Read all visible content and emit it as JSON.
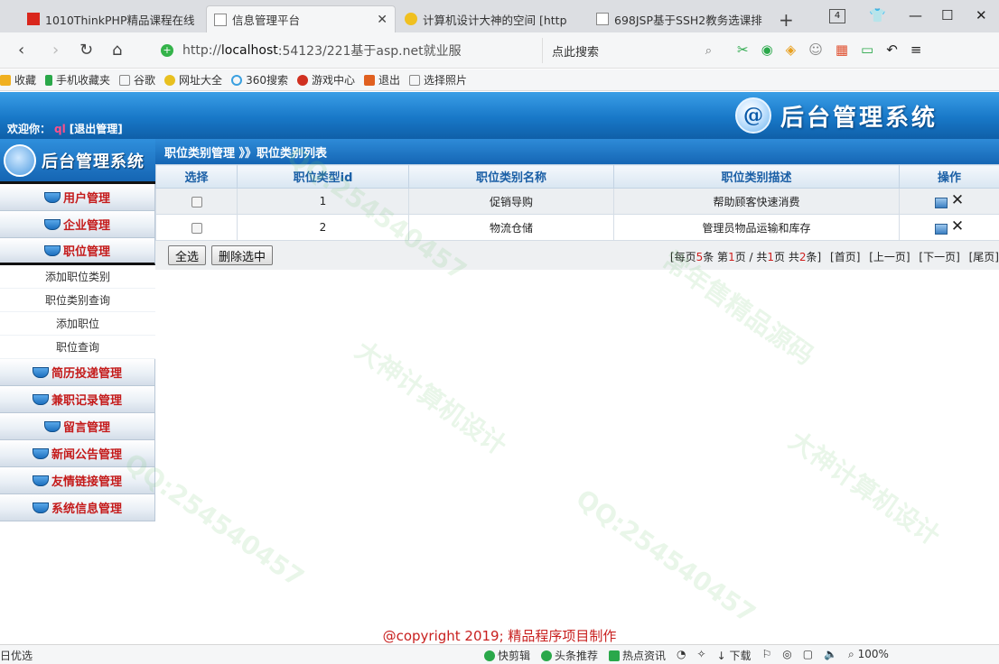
{
  "browser": {
    "tabs": [
      {
        "title": "1010ThinkPHP精品课程在线"
      },
      {
        "title": "信息管理平台"
      },
      {
        "title": "计算机设计大神的空间 [http"
      },
      {
        "title": "698JSP基于SSH2教务选课排"
      }
    ],
    "tab_count": "4",
    "url_prefix": "http://",
    "url_host": "localhost",
    "url_rest": ":54123/221基于asp.net就业服",
    "search_placeholder": "点此搜索",
    "bookmarks": [
      "收藏",
      "手机收藏夹",
      "谷歌",
      "网址大全",
      "360搜索",
      "游戏中心",
      "退出",
      "选择照片"
    ]
  },
  "header": {
    "welcome_label": "欢迎你：",
    "username": "ql",
    "logout_label": "[退出管理]",
    "brand_logo": "@",
    "brand_title": "后台管理系统"
  },
  "sidebar": {
    "logo_title": "后台管理系统",
    "menus": [
      {
        "label": "用户管理"
      },
      {
        "label": "企业管理"
      },
      {
        "label": "职位管理",
        "sub": [
          "添加职位类别",
          "职位类别查询",
          "添加职位",
          "职位查询"
        ]
      },
      {
        "label": "简历投递管理"
      },
      {
        "label": "兼职记录管理"
      },
      {
        "label": "留言管理"
      },
      {
        "label": "新闻公告管理"
      },
      {
        "label": "友情链接管理"
      },
      {
        "label": "系统信息管理"
      }
    ]
  },
  "main": {
    "breadcrumb": "职位类别管理 》》职位类别列表",
    "columns": [
      "选择",
      "职位类型id",
      "职位类别名称",
      "职位类别描述",
      "操作"
    ],
    "rows": [
      {
        "id": "1",
        "name": "促销导购",
        "desc": "帮助顾客快速消费"
      },
      {
        "id": "2",
        "name": "物流仓储",
        "desc": "管理员物品运输和库存"
      }
    ],
    "select_all_label": "全选",
    "delete_selected_label": "删除选中",
    "pager": {
      "pre": "[每页",
      "per_page": "5",
      "mid1": "条 第",
      "page": "1",
      "mid2": "页 / 共",
      "total_pages": "1",
      "mid3": "页 共",
      "total": "2",
      "post": "条]",
      "first": "[首页]",
      "prev": "[上一页]",
      "next": "[下一页]",
      "last": "[尾页]"
    }
  },
  "footer": {
    "copyright": "@copyright 2019; 精品程序项目制作"
  },
  "statusbar": {
    "left": "日优选",
    "items": [
      "快剪辑",
      "头条推荐",
      "热点资讯",
      "下载",
      "100%"
    ]
  },
  "watermark": [
    "QQ:254540457",
    "大神计算机设计",
    "常年售精品源码"
  ]
}
